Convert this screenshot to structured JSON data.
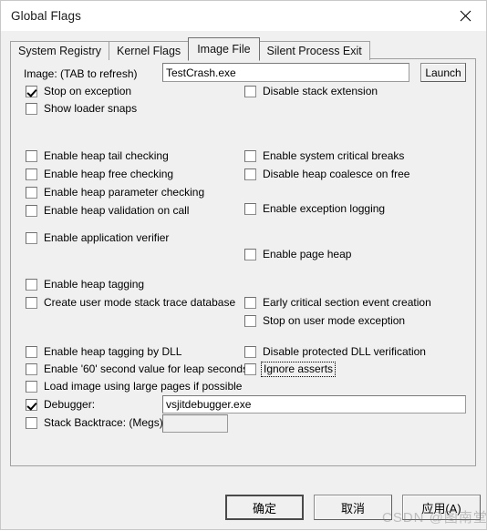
{
  "window": {
    "title": "Global Flags",
    "close_icon": "close-icon"
  },
  "tabs": [
    {
      "label": "System Registry",
      "active": false
    },
    {
      "label": "Kernel Flags",
      "active": false
    },
    {
      "label": "Image File",
      "active": true
    },
    {
      "label": "Silent Process Exit",
      "active": false
    }
  ],
  "image_file": {
    "image_label": "Image: (TAB to refresh)",
    "image_value": "TestCrash.exe",
    "image_placeholder": "",
    "launch_label": "Launch",
    "debugger_value": "vsjitdebugger.exe",
    "debugger_placeholder": "",
    "stack_backtrace_value": "",
    "stack_backtrace_placeholder": "",
    "checkboxes": {
      "stop_on_exception": {
        "label": "Stop on exception",
        "checked": true
      },
      "show_loader_snaps": {
        "label": "Show loader snaps",
        "checked": false
      },
      "disable_stack_extension": {
        "label": "Disable stack extension",
        "checked": false
      },
      "enable_heap_tail_checking": {
        "label": "Enable heap tail checking",
        "checked": false
      },
      "enable_heap_free_checking": {
        "label": "Enable heap free checking",
        "checked": false
      },
      "enable_heap_parameter_checking": {
        "label": "Enable heap parameter checking",
        "checked": false
      },
      "enable_heap_validation_on_call": {
        "label": "Enable heap validation on call",
        "checked": false
      },
      "enable_system_critical_breaks": {
        "label": "Enable system critical breaks",
        "checked": false
      },
      "disable_heap_coalesce_on_free": {
        "label": "Disable heap coalesce on free",
        "checked": false
      },
      "enable_exception_logging": {
        "label": "Enable exception logging",
        "checked": false
      },
      "enable_application_verifier": {
        "label": "Enable application verifier",
        "checked": false
      },
      "enable_page_heap": {
        "label": "Enable page heap",
        "checked": false
      },
      "enable_heap_tagging": {
        "label": "Enable heap tagging",
        "checked": false
      },
      "create_user_mode_stack_trace_database": {
        "label": "Create user mode stack trace database",
        "checked": false
      },
      "early_critical_section_event_creation": {
        "label": "Early critical section event creation",
        "checked": false
      },
      "stop_on_user_mode_exception": {
        "label": "Stop on user mode exception",
        "checked": false
      },
      "enable_heap_tagging_by_dll": {
        "label": "Enable heap tagging by DLL",
        "checked": false
      },
      "disable_protected_dll_verification": {
        "label": "Disable protected DLL verification",
        "checked": false
      },
      "enable_60_second_value_for_leap_seconds": {
        "label": "Enable '60' second value for leap seconds",
        "checked": false
      },
      "ignore_asserts": {
        "label": "Ignore asserts",
        "checked": false,
        "focused": true
      },
      "load_image_using_large_pages": {
        "label": "Load image using large pages if possible",
        "checked": false
      },
      "debugger": {
        "label": "Debugger:",
        "checked": true
      },
      "stack_backtrace": {
        "label": "Stack Backtrace: (Megs)",
        "checked": false
      }
    }
  },
  "footer": {
    "ok_label": "确定",
    "cancel_label": "取消",
    "apply_label": "应用(A)"
  },
  "watermark": {
    "text": "CSDN @图南堂"
  }
}
